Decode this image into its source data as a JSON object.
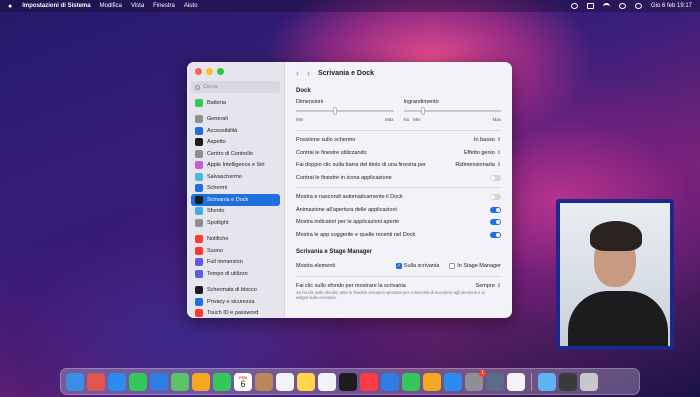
{
  "menubar": {
    "app_name": "Impostazioni di Sistema",
    "menus": [
      "Modifica",
      "Vista",
      "Finestra",
      "Aiuto"
    ],
    "clock": "Gio 6 feb  19:17"
  },
  "window": {
    "title": "Scrivania e Dock",
    "search_placeholder": "Cerca",
    "sidebar_groups": [
      [
        {
          "label": "Batteria",
          "color": "#34c759"
        }
      ],
      [
        {
          "label": "Generali",
          "color": "#8e8e93"
        },
        {
          "label": "Accessibilità",
          "color": "#1f6fe0"
        },
        {
          "label": "Aspetto",
          "color": "#1d1d1f"
        },
        {
          "label": "Centro di Controllo",
          "color": "#8e8e93"
        },
        {
          "label": "Apple Intelligence e Siri",
          "color": "#c95bd9"
        },
        {
          "label": "Salvaschermo",
          "color": "#4fb3e8"
        },
        {
          "label": "Schermi",
          "color": "#1f6fe0"
        },
        {
          "label": "Scrivania e Dock",
          "color": "#1d1d1f"
        },
        {
          "label": "Sfondo",
          "color": "#3bb0e8"
        },
        {
          "label": "Spotlight",
          "color": "#8e8e93"
        }
      ],
      [
        {
          "label": "Notifiche",
          "color": "#ff3b30"
        },
        {
          "label": "Suono",
          "color": "#ff3b30"
        },
        {
          "label": "Full immersion",
          "color": "#5e5ce6"
        },
        {
          "label": "Tempo di utilizzo",
          "color": "#5e5ce6"
        }
      ],
      [
        {
          "label": "Schermata di blocco",
          "color": "#1d1d1f"
        },
        {
          "label": "Privacy e sicurezza",
          "color": "#1f6fe0"
        },
        {
          "label": "Touch ID e password",
          "color": "#ff3b30"
        }
      ]
    ],
    "active_item": "Scrivania e Dock",
    "dock_section": {
      "title": "Dock",
      "size": {
        "label": "Dimensioni",
        "min": "Min",
        "max": "Max",
        "value": 0.38
      },
      "magnification": {
        "label": "Ingrandimento",
        "no": "No",
        "min": "Min",
        "max": "Max",
        "value": 0.18
      },
      "rows": [
        {
          "label": "Posizione sullo schermo",
          "type": "select",
          "value": "In basso"
        },
        {
          "label": "Contrai le finestre utilizzando",
          "type": "select",
          "value": "Effetto genio"
        },
        {
          "label": "Fai doppio clic sulla barra del titolo di una finestra per",
          "type": "select",
          "value": "Ridimensionarla"
        },
        {
          "label": "Contrai le finestre in icona applicazione",
          "type": "toggle",
          "on": false
        },
        {
          "label": "Mostra e nascondi automaticamente il Dock",
          "type": "toggle",
          "on": false
        },
        {
          "label": "Animazione all'apertura delle applicazioni",
          "type": "toggle",
          "on": true
        },
        {
          "label": "Mostra indicatori per le applicazioni aperte",
          "type": "toggle",
          "on": true
        },
        {
          "label": "Mostra le app suggerite e quelle recenti nel Dock",
          "type": "toggle",
          "on": true
        }
      ]
    },
    "stage_section": {
      "title": "Scrivania e Stage Manager",
      "show_items_label": "Mostra elementi",
      "opt_desktop": "Sulla scrivania",
      "opt_desktop_checked": true,
      "opt_stage": "In Stage Manager",
      "opt_stage_checked": false,
      "click_label": "Fai clic sullo sfondo per mostrare la scrivania",
      "click_value": "Sempre",
      "click_note": "Se fai clic sullo sfondo, tutte le finestre verranno spostate per consentirti di accedere agli elementi e ai widget sulla scrivania."
    }
  },
  "dock": {
    "icons": [
      {
        "name": "finder-icon",
        "color": "#3a8ee6"
      },
      {
        "name": "launchpad-icon",
        "color": "#e0574f"
      },
      {
        "name": "safari-icon",
        "color": "#2b8cf0"
      },
      {
        "name": "messages-icon",
        "color": "#34c759"
      },
      {
        "name": "mail-icon",
        "color": "#2f7de0"
      },
      {
        "name": "maps-icon",
        "color": "#5ac467"
      },
      {
        "name": "photos-icon",
        "color": "#f5a623"
      },
      {
        "name": "facetime-icon",
        "color": "#34c759"
      },
      {
        "name": "calendar-icon",
        "color": "#ffffff"
      },
      {
        "name": "contacts-icon",
        "color": "#b9855a"
      },
      {
        "name": "reminders-icon",
        "color": "#f2f2f7"
      },
      {
        "name": "notes-icon",
        "color": "#ffd54a"
      },
      {
        "name": "freeform-icon",
        "color": "#f2f2f7"
      },
      {
        "name": "tv-icon",
        "color": "#1d1d1f"
      },
      {
        "name": "music-icon",
        "color": "#fc3c44"
      },
      {
        "name": "keynote-icon",
        "color": "#2f7de0"
      },
      {
        "name": "numbers-icon",
        "color": "#34c759"
      },
      {
        "name": "pages-icon",
        "color": "#f5a623"
      },
      {
        "name": "app-store-icon",
        "color": "#2b8cf0"
      },
      {
        "name": "system-settings-icon",
        "color": "#8e8e93"
      },
      {
        "name": "quicktime-icon",
        "color": "#5b6b8a"
      },
      {
        "name": "textedit-icon",
        "color": "#f2f2f7"
      }
    ],
    "right_icons": [
      {
        "name": "downloads-folder-icon",
        "color": "#5fb3f0"
      },
      {
        "name": "screen-recording-icon",
        "color": "#3a3a3c"
      },
      {
        "name": "trash-icon",
        "color": "#c7c7cc"
      }
    ],
    "calendar_day": "6",
    "calendar_month": "FEB",
    "settings_badge": "1"
  }
}
